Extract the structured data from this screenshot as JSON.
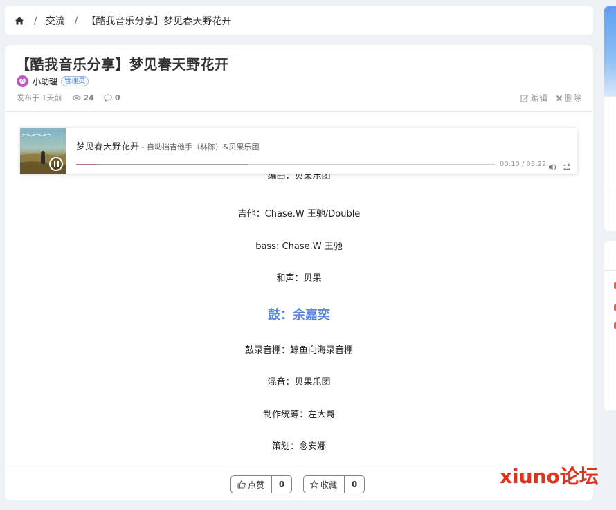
{
  "breadcrumb": {
    "home_icon": "home-icon",
    "items": [
      "交流",
      "【酷我音乐分享】梦见春天野花开"
    ]
  },
  "post": {
    "title": "【酷我音乐分享】梦见春天野花开",
    "author": "小助理",
    "role_badge": "管理员",
    "posted": "发布于 1天前",
    "views": "24",
    "comments": "0",
    "edit_label": "编辑",
    "delete_label": "删除"
  },
  "player": {
    "song": "梦见春天野花开",
    "artist": " - 自动挡吉他手（林陈）&贝果乐团",
    "time": "00:10 / 03:22",
    "played_fraction": 0.05,
    "loaded_fraction": 0.41
  },
  "lyrics_clipped": "编曲：贝果乐团",
  "lyrics": [
    "吉他：Chase.W 王驰/Double",
    "bass: Chase.W 王驰",
    "和声：贝果",
    "鼓：余嘉奕",
    "鼓录音棚：鲸鱼向海录音棚",
    "混音：贝果乐团",
    "制作统筹：左大哥",
    "策划：念安娜"
  ],
  "footer": {
    "like_label": "点赞",
    "like_count": "0",
    "fav_label": "收藏",
    "fav_count": "0"
  },
  "watermark": "xiuno论坛",
  "colors": {
    "highlight": "#5b87e3",
    "watermark": "#e0321f",
    "badge": "#4a7fd8"
  }
}
